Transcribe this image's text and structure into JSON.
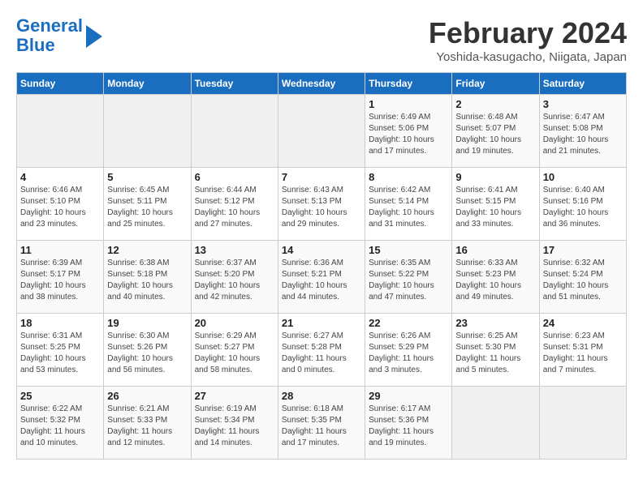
{
  "logo": {
    "line1": "General",
    "line2": "Blue"
  },
  "title": "February 2024",
  "location": "Yoshida-kasugacho, Niigata, Japan",
  "weekdays": [
    "Sunday",
    "Monday",
    "Tuesday",
    "Wednesday",
    "Thursday",
    "Friday",
    "Saturday"
  ],
  "weeks": [
    [
      {
        "day": "",
        "info": ""
      },
      {
        "day": "",
        "info": ""
      },
      {
        "day": "",
        "info": ""
      },
      {
        "day": "",
        "info": ""
      },
      {
        "day": "1",
        "info": "Sunrise: 6:49 AM\nSunset: 5:06 PM\nDaylight: 10 hours\nand 17 minutes."
      },
      {
        "day": "2",
        "info": "Sunrise: 6:48 AM\nSunset: 5:07 PM\nDaylight: 10 hours\nand 19 minutes."
      },
      {
        "day": "3",
        "info": "Sunrise: 6:47 AM\nSunset: 5:08 PM\nDaylight: 10 hours\nand 21 minutes."
      }
    ],
    [
      {
        "day": "4",
        "info": "Sunrise: 6:46 AM\nSunset: 5:10 PM\nDaylight: 10 hours\nand 23 minutes."
      },
      {
        "day": "5",
        "info": "Sunrise: 6:45 AM\nSunset: 5:11 PM\nDaylight: 10 hours\nand 25 minutes."
      },
      {
        "day": "6",
        "info": "Sunrise: 6:44 AM\nSunset: 5:12 PM\nDaylight: 10 hours\nand 27 minutes."
      },
      {
        "day": "7",
        "info": "Sunrise: 6:43 AM\nSunset: 5:13 PM\nDaylight: 10 hours\nand 29 minutes."
      },
      {
        "day": "8",
        "info": "Sunrise: 6:42 AM\nSunset: 5:14 PM\nDaylight: 10 hours\nand 31 minutes."
      },
      {
        "day": "9",
        "info": "Sunrise: 6:41 AM\nSunset: 5:15 PM\nDaylight: 10 hours\nand 33 minutes."
      },
      {
        "day": "10",
        "info": "Sunrise: 6:40 AM\nSunset: 5:16 PM\nDaylight: 10 hours\nand 36 minutes."
      }
    ],
    [
      {
        "day": "11",
        "info": "Sunrise: 6:39 AM\nSunset: 5:17 PM\nDaylight: 10 hours\nand 38 minutes."
      },
      {
        "day": "12",
        "info": "Sunrise: 6:38 AM\nSunset: 5:18 PM\nDaylight: 10 hours\nand 40 minutes."
      },
      {
        "day": "13",
        "info": "Sunrise: 6:37 AM\nSunset: 5:20 PM\nDaylight: 10 hours\nand 42 minutes."
      },
      {
        "day": "14",
        "info": "Sunrise: 6:36 AM\nSunset: 5:21 PM\nDaylight: 10 hours\nand 44 minutes."
      },
      {
        "day": "15",
        "info": "Sunrise: 6:35 AM\nSunset: 5:22 PM\nDaylight: 10 hours\nand 47 minutes."
      },
      {
        "day": "16",
        "info": "Sunrise: 6:33 AM\nSunset: 5:23 PM\nDaylight: 10 hours\nand 49 minutes."
      },
      {
        "day": "17",
        "info": "Sunrise: 6:32 AM\nSunset: 5:24 PM\nDaylight: 10 hours\nand 51 minutes."
      }
    ],
    [
      {
        "day": "18",
        "info": "Sunrise: 6:31 AM\nSunset: 5:25 PM\nDaylight: 10 hours\nand 53 minutes."
      },
      {
        "day": "19",
        "info": "Sunrise: 6:30 AM\nSunset: 5:26 PM\nDaylight: 10 hours\nand 56 minutes."
      },
      {
        "day": "20",
        "info": "Sunrise: 6:29 AM\nSunset: 5:27 PM\nDaylight: 10 hours\nand 58 minutes."
      },
      {
        "day": "21",
        "info": "Sunrise: 6:27 AM\nSunset: 5:28 PM\nDaylight: 11 hours\nand 0 minutes."
      },
      {
        "day": "22",
        "info": "Sunrise: 6:26 AM\nSunset: 5:29 PM\nDaylight: 11 hours\nand 3 minutes."
      },
      {
        "day": "23",
        "info": "Sunrise: 6:25 AM\nSunset: 5:30 PM\nDaylight: 11 hours\nand 5 minutes."
      },
      {
        "day": "24",
        "info": "Sunrise: 6:23 AM\nSunset: 5:31 PM\nDaylight: 11 hours\nand 7 minutes."
      }
    ],
    [
      {
        "day": "25",
        "info": "Sunrise: 6:22 AM\nSunset: 5:32 PM\nDaylight: 11 hours\nand 10 minutes."
      },
      {
        "day": "26",
        "info": "Sunrise: 6:21 AM\nSunset: 5:33 PM\nDaylight: 11 hours\nand 12 minutes."
      },
      {
        "day": "27",
        "info": "Sunrise: 6:19 AM\nSunset: 5:34 PM\nDaylight: 11 hours\nand 14 minutes."
      },
      {
        "day": "28",
        "info": "Sunrise: 6:18 AM\nSunset: 5:35 PM\nDaylight: 11 hours\nand 17 minutes."
      },
      {
        "day": "29",
        "info": "Sunrise: 6:17 AM\nSunset: 5:36 PM\nDaylight: 11 hours\nand 19 minutes."
      },
      {
        "day": "",
        "info": ""
      },
      {
        "day": "",
        "info": ""
      }
    ]
  ]
}
